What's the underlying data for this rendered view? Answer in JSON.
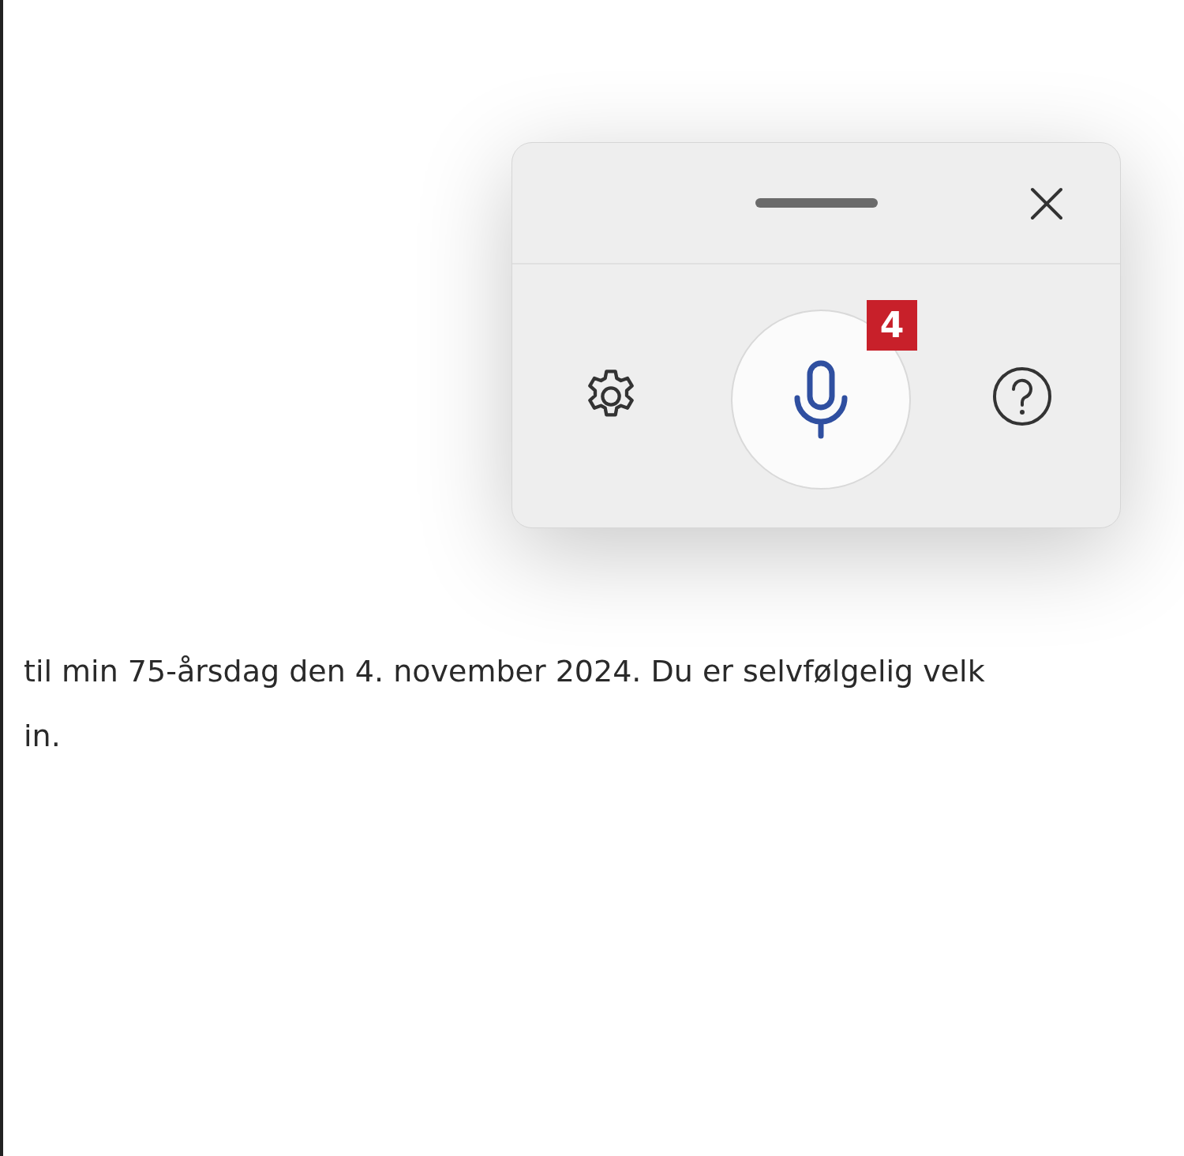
{
  "document": {
    "lines": [
      "til min 75-årsdag den 4. november 2024. Du er selvfølgelig velk",
      "in."
    ]
  },
  "dictation_panel": {
    "badge": "4"
  }
}
